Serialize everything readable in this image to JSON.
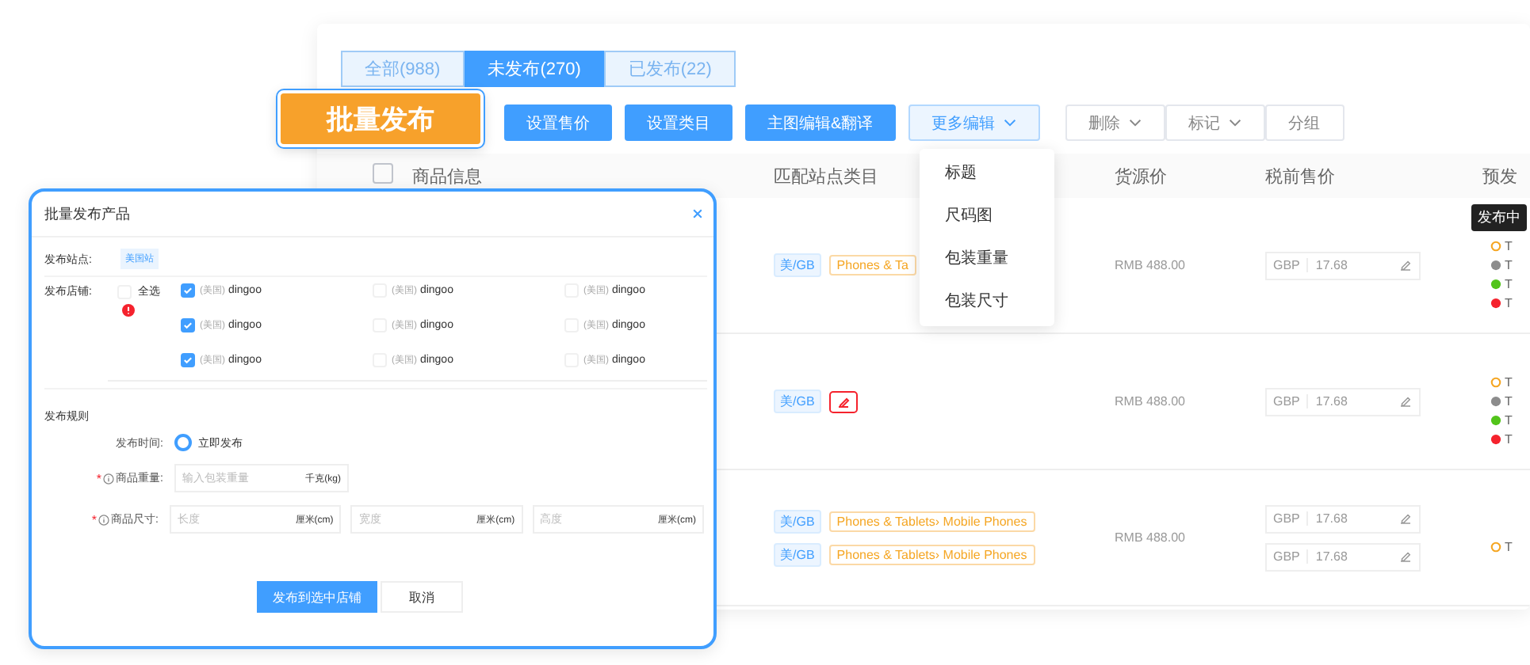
{
  "tabs": [
    {
      "label": "全部(988)",
      "selected": false
    },
    {
      "label": "未发布(270)",
      "selected": true
    },
    {
      "label": "已发布(22)",
      "selected": false
    }
  ],
  "batch_button": "批量发布",
  "toolbar": [
    {
      "label": "设置售价",
      "kind": "primary"
    },
    {
      "label": "设置类目",
      "kind": "primary"
    },
    {
      "label": "主图编辑&翻译",
      "kind": "primary"
    },
    {
      "label": "更多编辑",
      "kind": "light-dropdown"
    },
    {
      "label": "删除",
      "kind": "dropdown"
    },
    {
      "label": "标记",
      "kind": "dropdown"
    },
    {
      "label": "分组",
      "kind": "plain"
    }
  ],
  "more_menu": [
    "标题",
    "尺码图",
    "包装重量",
    "包装尺寸"
  ],
  "header_checked": false,
  "columns": [
    "商品信息",
    "匹配站点类目",
    "货源价",
    "税前售价",
    "预发"
  ],
  "tooltip": "发布中",
  "rows": [
    {
      "categories": [
        {
          "site": "美/GB",
          "kind": "text",
          "name": "Phones & Ta"
        }
      ],
      "source_price": "RMB 488.00",
      "prices": [
        {
          "currency": "GBP",
          "value": "17.68"
        }
      ],
      "statuses": [
        {
          "kind": "pending",
          "color": "#f5a623",
          "text": "T"
        },
        {
          "kind": "dot",
          "color": "#8c8c8c",
          "text": "T"
        },
        {
          "kind": "dot",
          "color": "#52c41a",
          "text": "T"
        },
        {
          "kind": "dot",
          "color": "#f5222d",
          "text": "T"
        }
      ]
    },
    {
      "categories": [
        {
          "site": "美/GB",
          "kind": "missing"
        }
      ],
      "source_price": "RMB 488.00",
      "prices": [
        {
          "currency": "GBP",
          "value": "17.68"
        }
      ],
      "statuses": [
        {
          "kind": "pending",
          "color": "#f5a623",
          "text": "T"
        },
        {
          "kind": "dot",
          "color": "#8c8c8c",
          "text": "T"
        },
        {
          "kind": "dot",
          "color": "#52c41a",
          "text": "T"
        },
        {
          "kind": "dot",
          "color": "#f5222d",
          "text": "T"
        }
      ]
    },
    {
      "categories": [
        {
          "site": "美/GB",
          "kind": "text",
          "name": "Phones & Tablets› Mobile Phones"
        },
        {
          "site": "美/GB",
          "kind": "text",
          "name": "Phones & Tablets› Mobile Phones"
        }
      ],
      "source_price": "RMB 488.00",
      "prices": [
        {
          "currency": "GBP",
          "value": "17.68"
        },
        {
          "currency": "GBP",
          "value": "17.68"
        }
      ],
      "statuses": [
        {
          "kind": "pending",
          "color": "#f5a623",
          "text": "T"
        }
      ]
    }
  ],
  "dialog": {
    "title": "批量发布产品",
    "site_label": "发布站点:",
    "site": "美国站",
    "shops_label": "发布店铺:",
    "select_all": {
      "label": "全选",
      "checked": false
    },
    "shops": [
      {
        "region": "(美国)",
        "name": "dingoo",
        "checked": true
      },
      {
        "region": "(美国)",
        "name": "dingoo",
        "checked": false
      },
      {
        "region": "(美国)",
        "name": "dingoo",
        "checked": false
      },
      {
        "region": "(美国)",
        "name": "dingoo",
        "checked": true
      },
      {
        "region": "(美国)",
        "name": "dingoo",
        "checked": false
      },
      {
        "region": "(美国)",
        "name": "dingoo",
        "checked": false
      },
      {
        "region": "(美国)",
        "name": "dingoo",
        "checked": true
      },
      {
        "region": "(美国)",
        "name": "dingoo",
        "checked": false
      },
      {
        "region": "(美国)",
        "name": "dingoo",
        "checked": false
      }
    ],
    "rules_title": "发布规则",
    "time_label": "发布时间:",
    "time_option": {
      "label": "立即发布",
      "selected": true
    },
    "weight": {
      "required_mark": "*",
      "label": "商品重量:",
      "placeholder": "输入包装重量",
      "unit": "千克(kg)"
    },
    "size": {
      "required_mark": "*",
      "label": "商品尺寸:",
      "fields": [
        {
          "placeholder": "长度",
          "unit": "厘米(cm)"
        },
        {
          "placeholder": "宽度",
          "unit": "厘米(cm)"
        },
        {
          "placeholder": "高度",
          "unit": "厘米(cm)"
        }
      ]
    },
    "buttons": [
      {
        "label": "发布到选中店铺",
        "kind": "primary"
      },
      {
        "label": "取消",
        "kind": "default"
      }
    ]
  }
}
